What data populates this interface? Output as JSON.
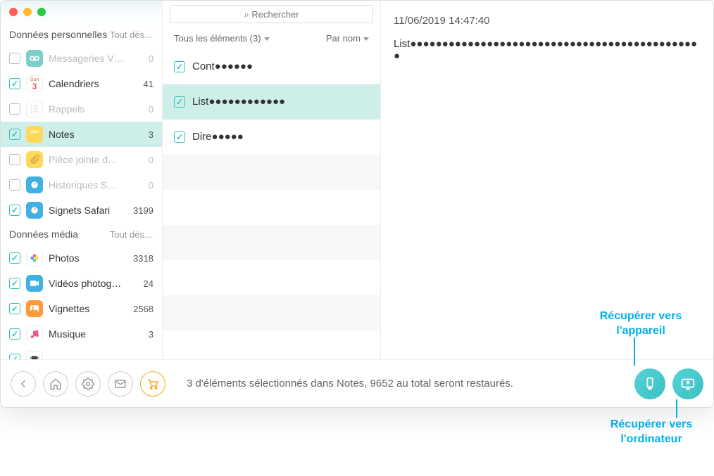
{
  "search": {
    "placeholder": "Rechercher"
  },
  "sidebar": {
    "sections": [
      {
        "title": "Données personnelles",
        "select_all": "Tout dés…",
        "items": [
          {
            "label": "Messageries V…",
            "count": 0,
            "checked": false,
            "enabled": false,
            "icon": "voicemail-icon",
            "color": "#7ad0c9"
          },
          {
            "label": "Calendriers",
            "count": 41,
            "checked": true,
            "enabled": true,
            "icon": "calendar-icon",
            "color": "#fff",
            "text_color": "#e85d55"
          },
          {
            "label": "Rappels",
            "count": 0,
            "checked": false,
            "enabled": false,
            "icon": "reminders-icon",
            "color": "#fff"
          },
          {
            "label": "Notes",
            "count": 3,
            "checked": true,
            "enabled": true,
            "selected": true,
            "icon": "notes-icon",
            "color": "#ffd95a"
          },
          {
            "label": "Pièce jointe d…",
            "count": 0,
            "checked": false,
            "enabled": false,
            "icon": "attachment-icon",
            "color": "#ffd95a"
          },
          {
            "label": "Historiques S…",
            "count": 0,
            "checked": false,
            "enabled": false,
            "icon": "safari-history-icon",
            "color": "#3fb1e3"
          },
          {
            "label": "Signets Safari",
            "count": 3199,
            "checked": true,
            "enabled": true,
            "icon": "safari-bookmarks-icon",
            "color": "#3fb1e3"
          }
        ]
      },
      {
        "title": "Données média",
        "select_all": "Tout dés…",
        "items": [
          {
            "label": "Photos",
            "count": 3318,
            "checked": true,
            "enabled": true,
            "icon": "photos-icon",
            "color": "#fff"
          },
          {
            "label": "Vidéos photog…",
            "count": 24,
            "checked": true,
            "enabled": true,
            "icon": "videos-icon",
            "color": "#3fb1e3"
          },
          {
            "label": "Vignettes",
            "count": 2568,
            "checked": true,
            "enabled": true,
            "icon": "thumbnails-icon",
            "color": "#ff9a3c"
          },
          {
            "label": "Musique",
            "count": 3,
            "checked": true,
            "enabled": true,
            "icon": "music-icon",
            "color": "#fff",
            "text_color": "#e85d88"
          },
          {
            "label": "",
            "count": "",
            "checked": true,
            "enabled": true,
            "icon": "film-icon",
            "color": "#fff"
          }
        ]
      }
    ]
  },
  "list": {
    "header_left": "Tous les éléments (3)",
    "header_right": "Par nom",
    "items": [
      {
        "title": "Cont●●●●●●",
        "checked": true,
        "selected": false
      },
      {
        "title": "List●●●●●●●●●●●●",
        "checked": true,
        "selected": true
      },
      {
        "title": "Dire●●●●●",
        "checked": true,
        "selected": false
      }
    ]
  },
  "detail": {
    "date": "11/06/2019 14:47:40",
    "body": "List●●●●●●●●●●●●●●●●●●●●●●●●●●●●●●●●●●●●●●●●●●●●●●"
  },
  "footer": {
    "status": "3 d'éléments sélectionnés dans Notes, 9652 au total seront restaurés."
  },
  "annotations": {
    "to_device": "Récupérer vers l'appareil",
    "to_computer": "Récupérer vers l'ordinateur"
  }
}
